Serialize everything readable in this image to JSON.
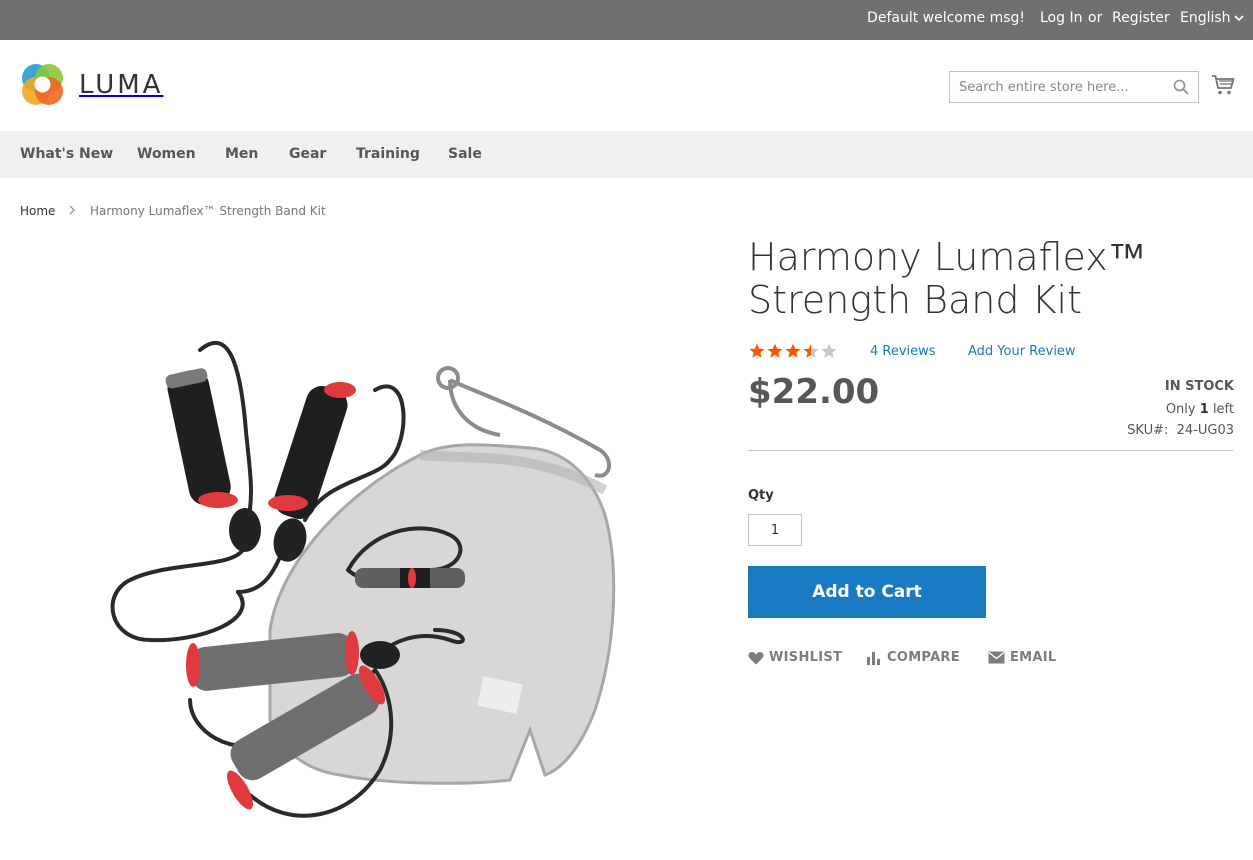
{
  "topbar": {
    "welcome": "Default welcome msg!",
    "login": "Log In",
    "or": "or",
    "register": "Register",
    "language": "English"
  },
  "header": {
    "logo_text": "LUMA",
    "search_placeholder": "Search entire store here..."
  },
  "nav": {
    "items": [
      {
        "label": "What's New"
      },
      {
        "label": "Women"
      },
      {
        "label": "Men"
      },
      {
        "label": "Gear"
      },
      {
        "label": "Training"
      },
      {
        "label": "Sale"
      }
    ]
  },
  "breadcrumb": {
    "home": "Home",
    "current": "Harmony Lumaflex™ Strength Band Kit"
  },
  "product": {
    "title": "Harmony Lumaflex™ Strength Band Kit",
    "rating": 3.5,
    "rating_max": 5,
    "reviews": "4  Reviews",
    "add_review": "Add Your Review",
    "price": "$22.00",
    "stock": "In stock",
    "only_prefix": "Only",
    "only_count": "1",
    "only_suffix": "left",
    "sku_label": "SKU#:",
    "sku_value": "24-UG03",
    "qty_label": "Qty",
    "qty_value": "1",
    "add_to_cart": "Add to Cart",
    "actions": {
      "wishlist": "Wishlist",
      "compare": "Compare",
      "email": "Email"
    }
  },
  "colors": {
    "topbar": "#6e716e",
    "nav_bg": "#f0f0f0",
    "link": "#1979c3",
    "star": "#ff5501",
    "button": "#1979c3"
  }
}
